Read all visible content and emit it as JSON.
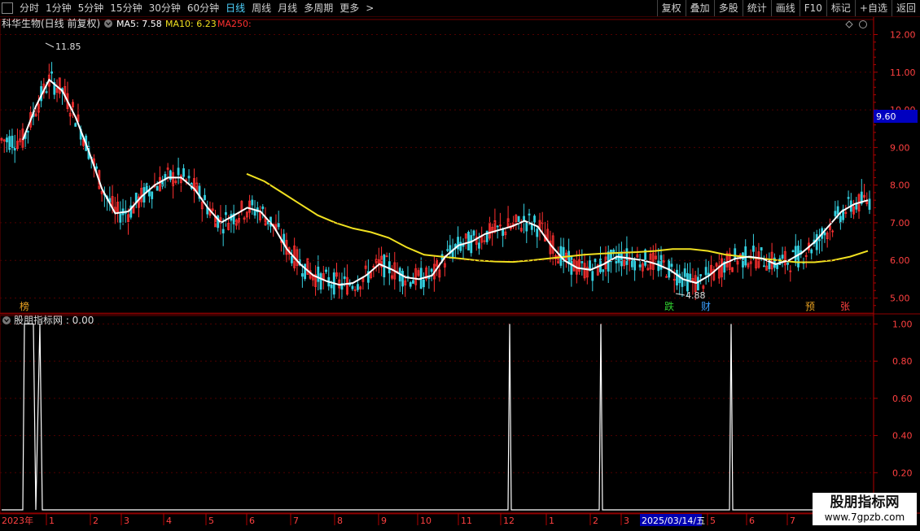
{
  "toolbar": {
    "items": [
      "分时",
      "1分钟",
      "5分钟",
      "15分钟",
      "30分钟",
      "60分钟",
      "日线",
      "周线",
      "月线",
      "多周期",
      "更多"
    ],
    "active_index": 6,
    "more_arrow": ">",
    "right_items": [
      "复权",
      "叠加",
      "多股",
      "统计",
      "画线",
      "F10",
      "标记",
      "+自选",
      "返回"
    ]
  },
  "main_chart": {
    "stock_name": "科华生物(日线 前复权)",
    "ma5_label": "MA5: 7.58",
    "ma10_label": "MA10: 6.23",
    "ma250_label": "MA250:",
    "high_label": "11.85",
    "low_label": "4.88",
    "current_price_label": "9.60",
    "y_ticks": [
      "12.00",
      "11.00",
      "10.00",
      "9.00",
      "8.00",
      "7.00",
      "6.00",
      "5.00"
    ],
    "markers": [
      {
        "text": "榜",
        "color": "#e8a020"
      },
      {
        "text": "跌",
        "color": "#30d030"
      },
      {
        "text": "财",
        "color": "#3a9fff"
      },
      {
        "text": "预",
        "color": "#e8a020"
      },
      {
        "text": "张",
        "color": "#ff4040"
      }
    ],
    "colors": {
      "up": "#ff3030",
      "down": "#35d0e0",
      "ma5": "#ffffff",
      "ma10": "#f0e020",
      "ma250": "#ff3030"
    }
  },
  "indicator": {
    "name": "股朋指标网 : 0.00",
    "y_ticks": [
      "1.00",
      "0.80",
      "0.60",
      "0.40",
      "0.20"
    ]
  },
  "x_axis": {
    "labels": [
      "2023年",
      "1",
      "2",
      "3",
      "4",
      "5",
      "6",
      "7",
      "8",
      "9",
      "10",
      "11",
      "12",
      "1",
      "2",
      "3",
      "2025/03/14/五",
      "5",
      "6",
      "7"
    ]
  },
  "watermark": {
    "line1": "股朋指标网",
    "line2": "www.7gpzb.com"
  },
  "chart_data": [
    {
      "type": "line",
      "title": "科华生物(日线 前复权)",
      "ylim": [
        4.6,
        12.4
      ],
      "series": [
        {
          "name": "MA5",
          "values": [
            9.2,
            10.1,
            10.8,
            10.5,
            9.8,
            8.9,
            7.9,
            7.25,
            7.3,
            7.7,
            8.0,
            8.2,
            8.2,
            7.9,
            7.4,
            7.0,
            7.2,
            7.4,
            7.3,
            6.9,
            6.3,
            5.9,
            5.6,
            5.45,
            5.35,
            5.4,
            5.6,
            5.9,
            5.75,
            5.55,
            5.5,
            5.6,
            6.1,
            6.4,
            6.5,
            6.7,
            6.8,
            6.9,
            7.05,
            6.9,
            6.4,
            6.0,
            5.8,
            5.75,
            5.9,
            6.1,
            6.05,
            6.0,
            5.9,
            5.75,
            5.5,
            5.4,
            5.6,
            5.9,
            6.05,
            6.1,
            6.05,
            5.9,
            6.0,
            6.2,
            6.5,
            6.9,
            7.3,
            7.5,
            7.6
          ]
        },
        {
          "name": "MA10",
          "values": [
            8.3,
            8.1,
            7.8,
            7.5,
            7.2,
            7.0,
            6.85,
            6.75,
            6.6,
            6.35,
            6.15,
            6.1,
            6.05,
            6.0,
            5.97,
            5.96,
            6.0,
            6.05,
            6.1,
            6.15,
            6.18,
            6.2,
            6.22,
            6.25,
            6.3,
            6.3,
            6.25,
            6.15,
            6.1,
            6.05,
            6.0,
            5.95,
            5.95,
            6.0,
            6.1,
            6.25
          ]
        },
        {
          "name": "MA250",
          "values": []
        }
      ]
    },
    {
      "type": "line",
      "title": "股朋指标网",
      "ylim": [
        0,
        1.05
      ],
      "series": [
        {
          "name": "股朋指标网",
          "values": [
            0,
            0,
            1,
            1,
            0,
            1,
            0,
            0,
            0,
            0,
            1,
            0,
            0,
            1,
            0,
            0,
            1,
            0,
            0,
            0
          ]
        }
      ]
    }
  ]
}
